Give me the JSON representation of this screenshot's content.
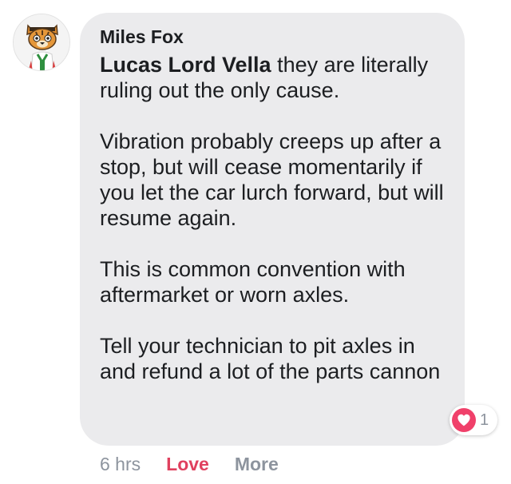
{
  "comment": {
    "author": "Miles Fox",
    "mention": "Lucas Lord Vella",
    "first_line_rest": " they are literally ruling out the only cause.",
    "paragraphs": [
      "Vibration probably creeps up after a stop, but will cease momentarily if you let the car lurch forward, but will resume again.",
      "This is common convention with aftermarket or worn axles.",
      "Tell your technician to pit axles in and refund a lot of the parts cannon"
    ],
    "reaction": {
      "icon": "heart-icon",
      "count": "1",
      "color": "#f0406a"
    },
    "actions": {
      "time": "6 hrs",
      "love_label": "Love",
      "love_color": "#e0405e",
      "more_label": "More"
    }
  }
}
